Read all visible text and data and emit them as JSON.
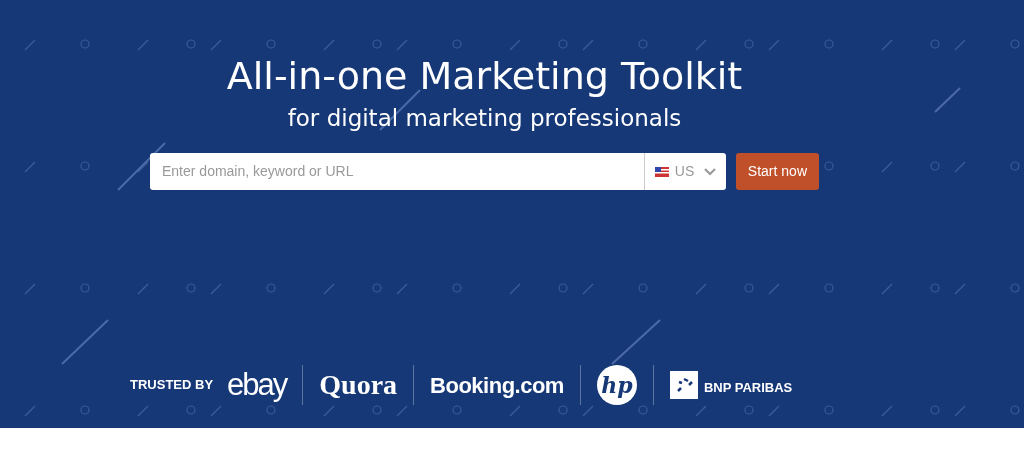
{
  "hero": {
    "title": "All-in-one Marketing Toolkit",
    "subtitle": "for digital marketing professionals"
  },
  "search": {
    "placeholder": "Enter domain, keyword or URL",
    "country": "US",
    "button": "Start now"
  },
  "trusted": {
    "label": "TRUSTED BY",
    "logos": [
      {
        "kind": "ebay",
        "text": "ebay"
      },
      {
        "kind": "quora",
        "text": "Quora"
      },
      {
        "kind": "booking",
        "text": "Booking.com"
      },
      {
        "kind": "hp",
        "text": "hp"
      },
      {
        "kind": "bnp",
        "text": "BNP PARIBAS"
      }
    ]
  }
}
